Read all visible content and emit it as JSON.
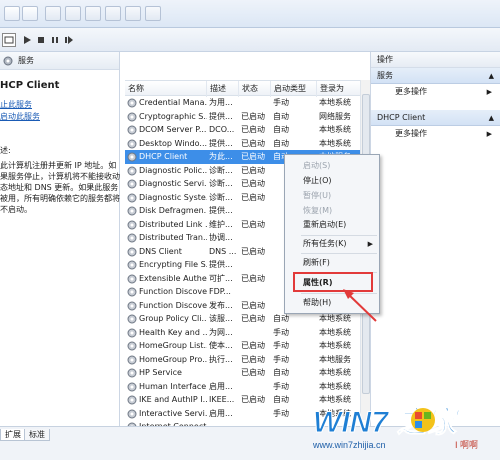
{
  "left_pane": {
    "header": "服务",
    "title": "HCP Client",
    "links": [
      "止此服务",
      "启动此服务"
    ],
    "desc_label": "述:",
    "desc": "此计算机注册并更新 IP 地址。如果服务停止，计算机将不能接收动态地址和 DNS 更新。如果此服务被用，所有明确依赖它的服务都将不启动。"
  },
  "list": {
    "columns": [
      "名称",
      "描述",
      "状态",
      "启动类型",
      "登录为"
    ],
    "rows": [
      {
        "name": "Credential Mana...",
        "desc": "为用...",
        "status": "",
        "startup": "手动",
        "logon": "本地系统"
      },
      {
        "name": "Cryptographic S...",
        "desc": "提供...",
        "status": "已启动",
        "startup": "自动",
        "logon": "网络服务"
      },
      {
        "name": "DCOM Server P...",
        "desc": "DCO...",
        "status": "已启动",
        "startup": "自动",
        "logon": "本地系统"
      },
      {
        "name": "Desktop Windo...",
        "desc": "提供...",
        "status": "已启动",
        "startup": "自动",
        "logon": "本地系统"
      },
      {
        "name": "DHCP Client",
        "desc": "为此...",
        "status": "已启动",
        "startup": "自动",
        "logon": "本地服务",
        "selected": true
      },
      {
        "name": "Diagnostic Polic...",
        "desc": "诊断...",
        "status": "已启动",
        "startup": "",
        "logon": ""
      },
      {
        "name": "Diagnostic Servi...",
        "desc": "诊断...",
        "status": "已启动",
        "startup": "",
        "logon": ""
      },
      {
        "name": "Diagnostic Syste...",
        "desc": "诊断...",
        "status": "已启动",
        "startup": "",
        "logon": ""
      },
      {
        "name": "Disk Defragmen...",
        "desc": "提供...",
        "status": "",
        "startup": "",
        "logon": ""
      },
      {
        "name": "Distributed Link ...",
        "desc": "维护...",
        "status": "已启动",
        "startup": "",
        "logon": ""
      },
      {
        "name": "Distributed Tran...",
        "desc": "协调...",
        "status": "",
        "startup": "",
        "logon": ""
      },
      {
        "name": "DNS Client",
        "desc": "DNS ...",
        "status": "已启动",
        "startup": "",
        "logon": ""
      },
      {
        "name": "Encrypting File S...",
        "desc": "提供...",
        "status": "",
        "startup": "",
        "logon": ""
      },
      {
        "name": "Extensible Authe...",
        "desc": "可扩...",
        "status": "已启动",
        "startup": "",
        "logon": ""
      },
      {
        "name": "Function Discove...",
        "desc": "FDP...",
        "status": "",
        "startup": "",
        "logon": ""
      },
      {
        "name": "Function Discove...",
        "desc": "发布...",
        "status": "已启动",
        "startup": "",
        "logon": ""
      },
      {
        "name": "Group Policy Cli...",
        "desc": "该服...",
        "status": "已启动",
        "startup": "自动",
        "logon": "本地系统"
      },
      {
        "name": "Health Key and ...",
        "desc": "为网...",
        "status": "",
        "startup": "手动",
        "logon": "本地系统"
      },
      {
        "name": "HomeGroup List...",
        "desc": "使本...",
        "status": "已启动",
        "startup": "手动",
        "logon": "本地系统"
      },
      {
        "name": "HomeGroup Pro...",
        "desc": "执行...",
        "status": "已启动",
        "startup": "手动",
        "logon": "本地服务"
      },
      {
        "name": "HP Service",
        "desc": "",
        "status": "已启动",
        "startup": "自动",
        "logon": "本地系统"
      },
      {
        "name": "Human Interface...",
        "desc": "启用...",
        "status": "",
        "startup": "手动",
        "logon": "本地系统"
      },
      {
        "name": "IKE and AuthIP I...",
        "desc": "IKEE...",
        "status": "已启动",
        "startup": "自动",
        "logon": "本地系统"
      },
      {
        "name": "Interactive Servi...",
        "desc": "启用...",
        "status": "",
        "startup": "手动",
        "logon": "本地系统"
      },
      {
        "name": "Internet Connect...",
        "desc": "",
        "status": "",
        "startup": "",
        "logon": ""
      }
    ]
  },
  "context_menu": {
    "items": [
      {
        "label": "启动(S)",
        "disabled": true
      },
      {
        "label": "停止(O)",
        "disabled": false
      },
      {
        "label": "暂停(U)",
        "disabled": true
      },
      {
        "label": "恢复(M)",
        "disabled": true
      },
      {
        "label": "重新启动(E)",
        "disabled": false
      },
      {
        "label": "所有任务(K)",
        "disabled": false,
        "submenu": true
      },
      {
        "label": "刷新(F)",
        "disabled": false
      },
      {
        "label": "属性(R)",
        "disabled": false,
        "highlighted": true
      },
      {
        "label": "帮助(H)",
        "disabled": false
      }
    ]
  },
  "right_pane": {
    "title": "操作",
    "section1": "服务",
    "item1": "更多操作",
    "section2": "DHCP Client",
    "item2": "更多操作"
  },
  "bottom_tabs": [
    "扩展",
    "标准"
  ],
  "watermark": {
    "text": "WIN7 之家",
    "url": "www.win7zhijia.cn",
    "tagline": "I 啊啊"
  },
  "colors": {
    "selection": "#3d8ee8",
    "highlight_box": "#e23a3a",
    "link": "#1a5bb5"
  }
}
